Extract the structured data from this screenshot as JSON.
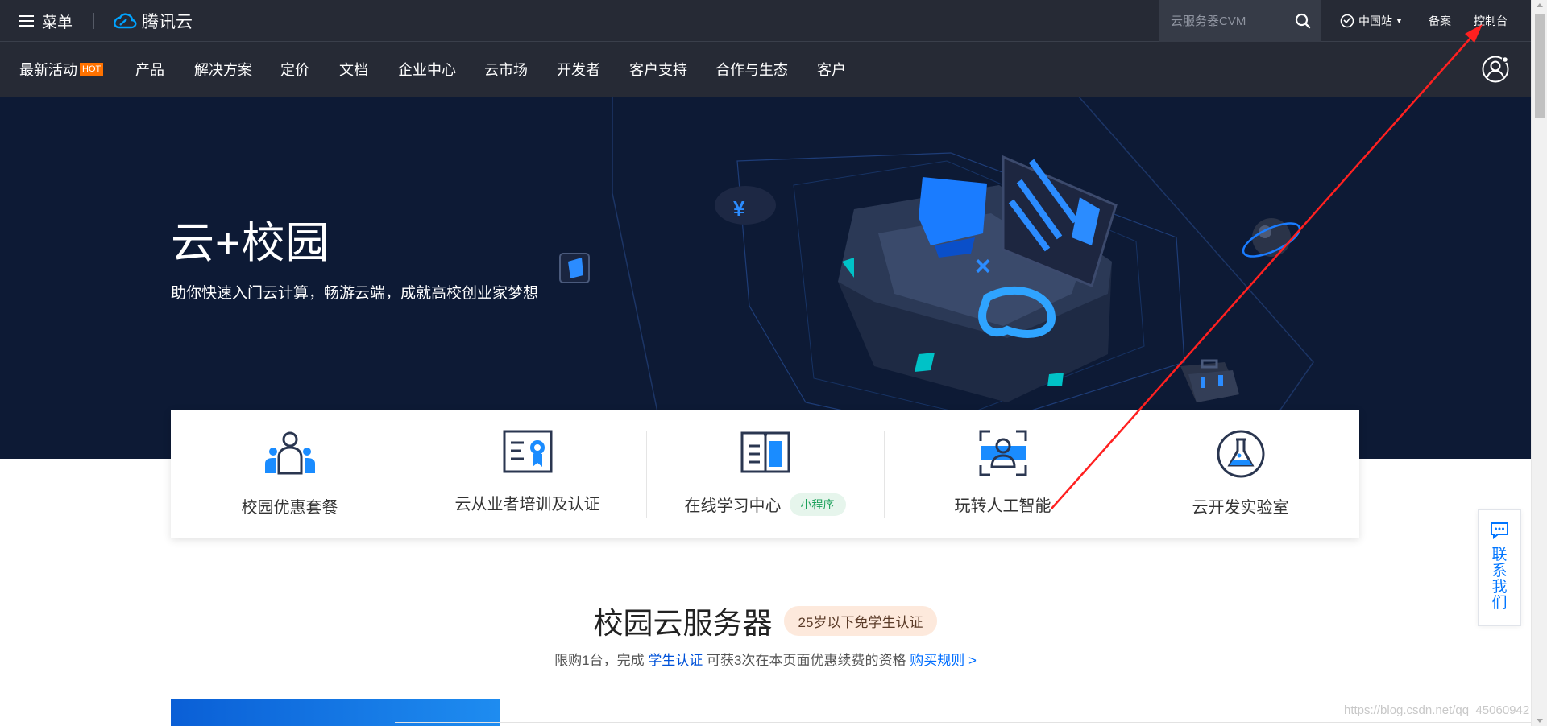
{
  "topbar": {
    "menu_label": "菜单",
    "logo_text": "腾讯云",
    "search_placeholder": "云服务器CVM",
    "region_label": "中国站",
    "beian_label": "备案",
    "console_label": "控制台"
  },
  "nav": {
    "items": [
      {
        "label": "最新活动"
      },
      {
        "label": "产品"
      },
      {
        "label": "解决方案"
      },
      {
        "label": "定价"
      },
      {
        "label": "文档"
      },
      {
        "label": "企业中心"
      },
      {
        "label": "云市场"
      },
      {
        "label": "开发者"
      },
      {
        "label": "客户支持"
      },
      {
        "label": "合作与生态"
      },
      {
        "label": "客户"
      }
    ],
    "hot_badge": "HOT"
  },
  "hero": {
    "title": "云+校园",
    "subtitle": "助你快速入门云计算，畅游云端，成就高校创业家梦想"
  },
  "cards": [
    {
      "label": "校园优惠套餐",
      "icon": "users-icon"
    },
    {
      "label": "云从业者培训及认证",
      "icon": "certificate-icon"
    },
    {
      "label": "在线学习中心",
      "icon": "book-icon",
      "badge": "小程序"
    },
    {
      "label": "玩转人工智能",
      "icon": "face-scan-icon"
    },
    {
      "label": "云开发实验室",
      "icon": "flask-icon"
    }
  ],
  "section": {
    "title": "校园云服务器",
    "badge": "25岁以下免学生认证",
    "desc_prefix": "限购1台，完成 ",
    "desc_link": "学生认证",
    "desc_middle": " 可获3次在本页面优惠续费的资格 ",
    "desc_rules": "购买规则 >"
  },
  "contact": {
    "label": "联系我们"
  },
  "watermark": "https://blog.csdn.net/qq_45060942",
  "colors": {
    "header_bg": "#262a35",
    "hero_bg": "#0d1a35",
    "accent_blue": "#006eff",
    "hot_orange": "#ff7200",
    "annotation_red": "#ff2020"
  }
}
